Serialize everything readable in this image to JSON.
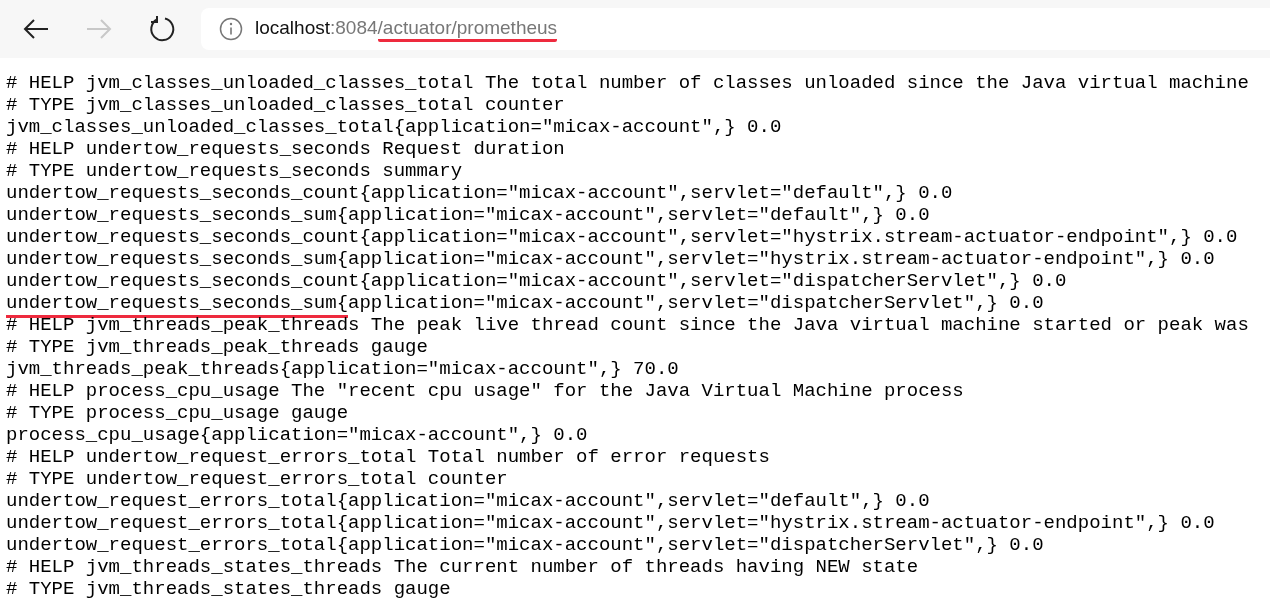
{
  "toolbar": {
    "back_disabled": false,
    "forward_disabled": true,
    "address": {
      "host": "localhost",
      "port": ":8084",
      "path": "/actuator/prometheus",
      "path_underlined": true
    }
  },
  "lines": [
    {
      "segments": [
        {
          "text": "# HELP jvm_classes_unloaded_classes_total The total number of classes unloaded since the Java virtual machine",
          "underlined": false
        }
      ]
    },
    {
      "segments": [
        {
          "text": "# TYPE jvm_classes_unloaded_classes_total counter",
          "underlined": false
        }
      ]
    },
    {
      "segments": [
        {
          "text": "jvm_classes_unloaded_classes_total{application=\"micax-account\",} 0.0",
          "underlined": false
        }
      ]
    },
    {
      "segments": [
        {
          "text": "# HELP undertow_requests_seconds Request duration",
          "underlined": false
        }
      ]
    },
    {
      "segments": [
        {
          "text": "# TYPE undertow_requests_seconds summary",
          "underlined": false
        }
      ]
    },
    {
      "segments": [
        {
          "text": "undertow_requests_seconds_count{application=\"micax-account\",servlet=\"default\",} 0.0",
          "underlined": false
        }
      ]
    },
    {
      "segments": [
        {
          "text": "undertow_requests_seconds_sum{application=\"micax-account\",servlet=\"default\",} 0.0",
          "underlined": false
        }
      ]
    },
    {
      "segments": [
        {
          "text": "undertow_requests_seconds_count{application=\"micax-account\",servlet=\"hystrix.stream-actuator-endpoint\",} 0.0",
          "underlined": false
        }
      ]
    },
    {
      "segments": [
        {
          "text": "undertow_requests_seconds_sum{application=\"micax-account\",servlet=\"hystrix.stream-actuator-endpoint\",} 0.0",
          "underlined": false
        }
      ]
    },
    {
      "segments": [
        {
          "text": "undertow_requests_seconds_count{application=\"micax-account\",servlet=\"dispatcherServlet\",} 0.0",
          "underlined": false
        }
      ]
    },
    {
      "segments": [
        {
          "text": "undertow_requests_seconds_sum{",
          "underlined": true
        },
        {
          "text": "application=\"micax-account\",servlet=\"dispatcherServlet\",} 0.0",
          "underlined": false
        }
      ]
    },
    {
      "segments": [
        {
          "text": "# HELP jvm_threads_peak_threads The peak live thread count since the Java virtual machine started or peak was",
          "underlined": false
        }
      ]
    },
    {
      "segments": [
        {
          "text": "# TYPE jvm_threads_peak_threads gauge",
          "underlined": false
        }
      ]
    },
    {
      "segments": [
        {
          "text": "jvm_threads_peak_threads{application=\"micax-account\",} 70.0",
          "underlined": false
        }
      ]
    },
    {
      "segments": [
        {
          "text": "# HELP process_cpu_usage The \"recent cpu usage\" for the Java Virtual Machine process",
          "underlined": false
        }
      ]
    },
    {
      "segments": [
        {
          "text": "# TYPE process_cpu_usage gauge",
          "underlined": false
        }
      ]
    },
    {
      "segments": [
        {
          "text": "process_cpu_usage{application=\"micax-account\",} 0.0",
          "underlined": false
        }
      ]
    },
    {
      "segments": [
        {
          "text": "# HELP undertow_request_errors_total Total number of error requests",
          "underlined": false
        }
      ]
    },
    {
      "segments": [
        {
          "text": "# TYPE undertow_request_errors_total counter",
          "underlined": false
        }
      ]
    },
    {
      "segments": [
        {
          "text": "undertow_request_errors_total{application=\"micax-account\",servlet=\"default\",} 0.0",
          "underlined": false
        }
      ]
    },
    {
      "segments": [
        {
          "text": "undertow_request_errors_total{application=\"micax-account\",servlet=\"hystrix.stream-actuator-endpoint\",} 0.0",
          "underlined": false
        }
      ]
    },
    {
      "segments": [
        {
          "text": "undertow_request_errors_total{application=\"micax-account\",servlet=\"dispatcherServlet\",} 0.0",
          "underlined": false
        }
      ]
    },
    {
      "segments": [
        {
          "text": "# HELP jvm_threads_states_threads The current number of threads having NEW state",
          "underlined": false
        }
      ]
    },
    {
      "segments": [
        {
          "text": "# TYPE jvm_threads_states_threads gauge",
          "underlined": false
        }
      ]
    }
  ]
}
